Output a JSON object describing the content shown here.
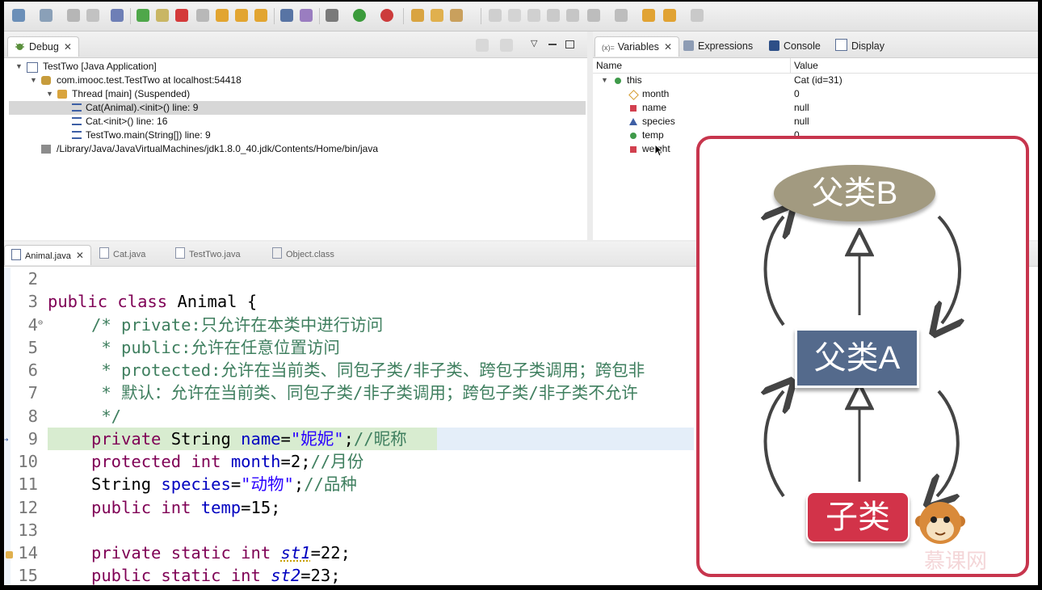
{
  "debug": {
    "tab_label": "Debug",
    "tree": [
      {
        "label": "TestTwo [Java Application]"
      },
      {
        "label": "com.imooc.test.TestTwo at localhost:54418"
      },
      {
        "label": "Thread [main] (Suspended)"
      },
      {
        "label": "Cat(Animal).<init>() line: 9"
      },
      {
        "label": "Cat.<init>() line: 16"
      },
      {
        "label": "TestTwo.main(String[]) line: 9"
      },
      {
        "label": "/Library/Java/JavaVirtualMachines/jdk1.8.0_40.jdk/Contents/Home/bin/java"
      }
    ]
  },
  "views": {
    "variables": "Variables",
    "expressions": "Expressions",
    "console": "Console",
    "display": "Display"
  },
  "variables": {
    "col_name": "Name",
    "col_value": "Value",
    "rows": [
      {
        "name": "this",
        "value": "Cat  (id=31)"
      },
      {
        "name": "month",
        "value": "0"
      },
      {
        "name": "name",
        "value": "null"
      },
      {
        "name": "species",
        "value": "null"
      },
      {
        "name": "temp",
        "value": "0"
      },
      {
        "name": "weight",
        "value": ""
      }
    ]
  },
  "editor": {
    "tabs": [
      "Animal.java",
      "Cat.java",
      "TestTwo.java",
      "Object.class"
    ],
    "line_numbers": [
      "2",
      "3",
      "4",
      "5",
      "6",
      "7",
      "8",
      "9",
      "10",
      "11",
      "12",
      "13",
      "14",
      "15"
    ],
    "lines": {
      "l3": {
        "kw1": "public",
        "kw2": "class",
        "rest": " Animal {"
      },
      "l4": "/* private:只允许在本类中进行访问",
      "l5": " * public:允许在任意位置访问",
      "l6": " * protected:允许在当前类、同包子类/非子类、跨包子类调用；跨包非",
      "l7": " * 默认：允许在当前类、同包子类/非子类调用；跨包子类/非子类不允许",
      "l8": " */",
      "l9": {
        "kw1": "private",
        "type": "String",
        "field": "name",
        "eq": "=",
        "str": "\"妮妮\"",
        "semi": ";",
        "cm": "//昵称"
      },
      "l10": {
        "kw1": "protected",
        "kw2": "int",
        "field": "month",
        "rest": "=2;",
        "cm": "//月份"
      },
      "l11": {
        "type": "String",
        "field": "species",
        "eq": "=",
        "str": "\"动物\"",
        "semi": ";",
        "cm": "//品种"
      },
      "l12": {
        "kw1": "public",
        "kw2": "int",
        "field": "temp",
        "rest": "=15;"
      },
      "l14": {
        "kw1": "private",
        "kw2": "static",
        "kw3": "int",
        "field": "st1",
        "rest": "=22;"
      },
      "l15": {
        "kw1": "public",
        "kw2": "static",
        "kw3": "int",
        "field": "st2",
        "rest": "=23;"
      }
    }
  },
  "diagram": {
    "parent_b": "父类B",
    "parent_a": "父类A",
    "child": "子类",
    "watermark": "慕课网"
  },
  "colors": {
    "overlay_border": "#c7354d",
    "parent_b_fill": "#a29a80",
    "parent_a_fill": "#546a8c",
    "child_fill": "#d23349",
    "highlight_line": "#d8ecd0"
  }
}
